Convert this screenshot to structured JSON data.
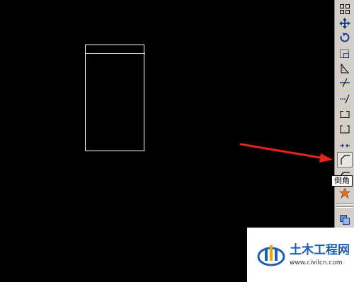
{
  "tooltip": {
    "text": "倒角"
  },
  "toolbar": {
    "tools": [
      "array-icon",
      "move-icon",
      "rotate-icon",
      "scale-icon",
      "stretch-icon",
      "trim-icon",
      "extend-icon",
      "break-at-point-icon",
      "break-icon",
      "join-icon",
      "chamfer-icon",
      "fillet-icon",
      "explode-icon",
      "draworder-icon"
    ],
    "active_tool": "chamfer-icon"
  },
  "watermark": {
    "name": "土木工程网",
    "url": "www.civilcn.com"
  },
  "colors": {
    "canvas": "#000000",
    "toolbar": "#d4d0c8",
    "arrow": "#e8221b",
    "watermark_text": "#1a5fb4"
  }
}
